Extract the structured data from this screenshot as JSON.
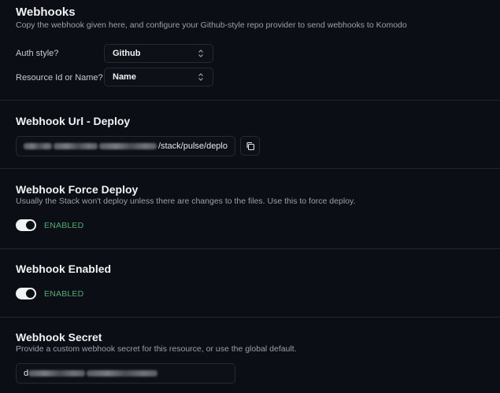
{
  "webhooks": {
    "title": "Webhooks",
    "description": "Copy the webhook given here, and configure your Github-style repo provider to send webhooks to Komodo",
    "auth_style": {
      "label": "Auth style?",
      "value": "Github"
    },
    "resource_id": {
      "label": "Resource Id or Name?",
      "value": "Name"
    }
  },
  "deploy_url": {
    "title": "Webhook Url - Deploy",
    "value_visible": "/stack/pulse/deplo",
    "copy_icon": "copy-icon"
  },
  "force_deploy": {
    "title": "Webhook Force Deploy",
    "description": "Usually the Stack won't deploy unless there are changes to the files. Use this to force deploy.",
    "status": "ENABLED"
  },
  "enabled": {
    "title": "Webhook Enabled",
    "status": "ENABLED"
  },
  "secret": {
    "title": "Webhook Secret",
    "description": "Provide a custom webhook secret for this resource, or use the global default.",
    "value_visible": "d"
  },
  "colors": {
    "background": "#0b0e14",
    "border": "#262a32",
    "enabled_green": "#4caf72"
  }
}
